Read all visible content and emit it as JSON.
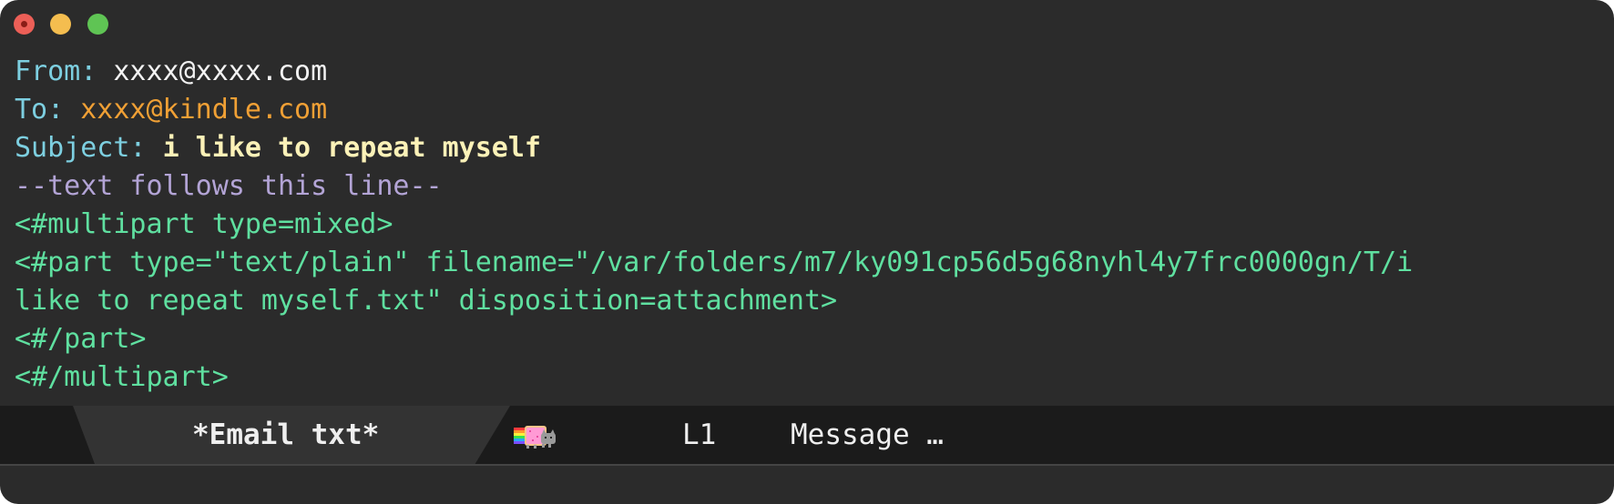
{
  "window": {
    "buttons": [
      "close",
      "minimize",
      "maximize"
    ]
  },
  "headers": {
    "from_key": "From:",
    "from_value": "xxxx@xxxx.com",
    "to_key": "To:",
    "to_value": "xxxx@kindle.com",
    "subject_key": "Subject:",
    "subject_value": "i like to repeat myself"
  },
  "body": {
    "separator": "--text follows this line--",
    "lines": [
      "<#multipart type=mixed>",
      "<#part type=\"text/plain\" filename=\"/var/folders/m7/ky091cp56d5g68nyhl4y7frc0000gn/T/i",
      "like to repeat myself.txt\" disposition=attachment>",
      "<#/part>",
      "<#/multipart>"
    ]
  },
  "modeline": {
    "buffer_name": "*Email txt*",
    "line_indicator": "L1",
    "major_mode": "Message …",
    "icon": "nyan-cat-icon"
  },
  "colors": {
    "background": "#2b2b2b",
    "header_key": "#7dcfe0",
    "to_value": "#f0a035",
    "subject_value": "#fcf2b8",
    "separator": "#b3a4d6",
    "mml_tags": "#5fe0a0",
    "modeline_bg": "#1b1b1b"
  }
}
